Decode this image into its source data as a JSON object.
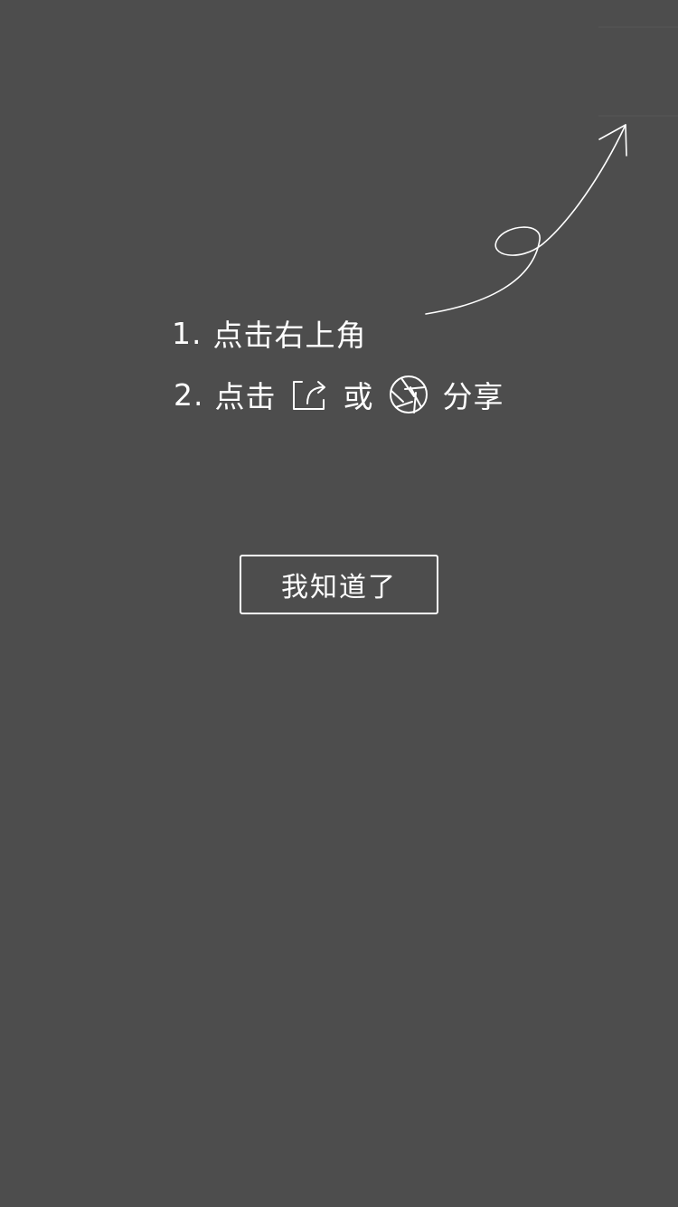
{
  "guide": {
    "step1": {
      "number": "1.",
      "text": "点击右上角"
    },
    "step2": {
      "number": "2.",
      "text_before": "点击",
      "share_icon": "share-arrow-icon",
      "or_text": "或",
      "moments_icon": "aperture-icon",
      "text_after": "分享"
    }
  },
  "button": {
    "label": "我知道了"
  },
  "colors": {
    "background": "#4d4d4d",
    "foreground": "#ffffff"
  }
}
